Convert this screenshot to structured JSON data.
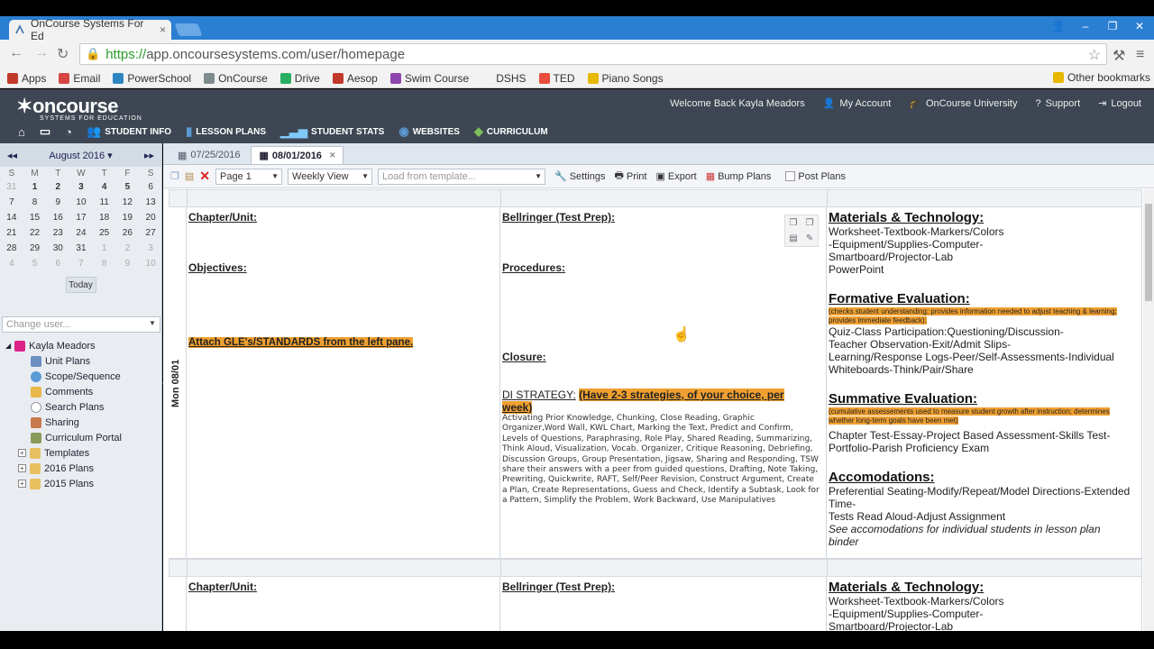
{
  "browser": {
    "tab_title": "OnCourse Systems For Ed",
    "url_https": "https://",
    "url_rest": "app.oncoursesystems.com/user/homepage",
    "bookmarks": [
      {
        "label": "Apps",
        "color": "#c0392b"
      },
      {
        "label": "Email",
        "color": "#d64541"
      },
      {
        "label": "PowerSchool",
        "color": "#2e86c1"
      },
      {
        "label": "OnCourse",
        "color": "#7f8c8d"
      },
      {
        "label": "Drive",
        "color": "#27ae60"
      },
      {
        "label": "Aesop",
        "color": "#c0392b"
      },
      {
        "label": "Swim Course",
        "color": "#8e44ad"
      },
      {
        "label": "DSHS",
        "color": "#f2f2f2"
      },
      {
        "label": "TED",
        "color": "#e74c3c"
      },
      {
        "label": "Piano Songs",
        "color": "#e6b800"
      }
    ],
    "other_bookmarks": "Other bookmarks"
  },
  "header": {
    "logo_main": "oncourse",
    "logo_sub": "SYSTEMS FOR EDUCATION",
    "welcome": "Welcome Back Kayla Meadors",
    "links": [
      "My Account",
      "OnCourse University",
      "Support",
      "Logout"
    ],
    "nav": [
      "STUDENT INFO",
      "LESSON PLANS",
      "STUDENT STATS",
      "WEBSITES",
      "CURRICULUM"
    ]
  },
  "calendar": {
    "month": "August 2016",
    "dow": [
      "S",
      "M",
      "T",
      "W",
      "T",
      "F",
      "S"
    ],
    "weeks": [
      [
        "31",
        "1",
        "2",
        "3",
        "4",
        "5",
        "6"
      ],
      [
        "7",
        "8",
        "9",
        "10",
        "11",
        "12",
        "13"
      ],
      [
        "14",
        "15",
        "16",
        "17",
        "18",
        "19",
        "20"
      ],
      [
        "21",
        "22",
        "23",
        "24",
        "25",
        "26",
        "27"
      ],
      [
        "28",
        "29",
        "30",
        "31",
        "1",
        "2",
        "3"
      ],
      [
        "4",
        "5",
        "6",
        "7",
        "8",
        "9",
        "10"
      ]
    ],
    "today": "Today"
  },
  "sidebar": {
    "change_user_placeholder": "Change user...",
    "user": "Kayla Meadors",
    "items": [
      "Unit Plans",
      "Scope/Sequence",
      "Comments",
      "Search Plans",
      "Sharing",
      "Curriculum Portal"
    ],
    "folders": [
      "Templates",
      "2016 Plans",
      "2015 Plans"
    ]
  },
  "tabs": {
    "tab1": "07/25/2016",
    "tab2": "08/01/2016"
  },
  "controls": {
    "page": "Page 1",
    "view": "Weekly View",
    "template": "Load from template...",
    "settings": "Settings",
    "print": "Print",
    "export": "Export",
    "bump": "Bump Plans",
    "post": "Post Plans"
  },
  "day1": {
    "label": "Mon 08/01",
    "chapter": "Chapter/Unit:",
    "objectives": "Objectives:",
    "attach": "Attach GLE's/STANDARDS from the left pane.",
    "bellringer": "Bellringer (Test Prep):",
    "procedures": "Procedures:",
    "closure": "Closure:",
    "di_label": "DI STRATEGY:",
    "di_highlight": "(Have 2-3 strategies, of your choice, per week)",
    "di_body": "Activating Prior Knowledge, Chunking, Close Reading, Graphic Organizer,Word Wall, KWL Chart, Marking the Text, Predict and Confirm, Levels of Questions, Paraphrasing, Role Play, Shared Reading, Summarizing, Think Aloud, Visualization, Vocab. Organizer, Critique Reasoning, Debriefing, Discussion Groups, Group Presentation, Jigsaw, Sharing and Responding, TSW share their answers with a peer from guided questions, Drafting, Note Taking, Prewriting, Quickwrite, RAFT, Self/Peer Revision, Construct Argument, Create a Plan, Create Representations, Guess and Check, Identify a Subtask, Look for a Pattern, Simplify the Problem, Work Backward, Use Manipulatives",
    "materials_h": "Materials & Technology:",
    "materials_t1": "Worksheet-Textbook-Markers/Colors",
    "materials_t2": "-Equipment/Supplies-Computer-",
    "materials_t3": "Smartboard/Projector-Lab",
    "materials_t4": "PowerPoint",
    "formative_h": "Formative Evaluation:",
    "formative_note": "(checks student understanding; provides information needed to adjust teaching & learning; provides immediate feedback):",
    "formative_t1": "Quiz-Class Participation:Questioning/Discussion-",
    "formative_t2": "Teacher Observation-Exit/Admit Slips-",
    "formative_t3": "Learning/Response Logs-Peer/Self-Assessments-Individual",
    "formative_t4": "Whiteboards-Think/Pair/Share",
    "summative_h": "Summative Evaluation:",
    "summative_note": "(cumulative assessements used to measure student growth after instruction; determines whether long-term goals have been met)",
    "summative_t1": "Chapter Test-Essay-Project Based Assessment-Skills Test-",
    "summative_t2": "Portfolio-Parish Proficiency Exam",
    "accom_h": "Accomodations:",
    "accom_t1": "Preferential Seating-Modify/Repeat/Model Directions-Extended",
    "accom_t2": "Time-",
    "accom_t3": "Tests Read Aloud-Adjust Assignment",
    "accom_t4": "See accomodations for individual students in lesson plan binder"
  },
  "day2": {
    "chapter": "Chapter/Unit:",
    "bellringer": "Bellringer (Test Prep):",
    "materials_h": "Materials & Technology:",
    "materials_t1": "Worksheet-Textbook-Markers/Colors",
    "materials_t2": "-Equipment/Supplies-Computer-",
    "materials_t3": "Smartboard/Projector-Lab"
  }
}
